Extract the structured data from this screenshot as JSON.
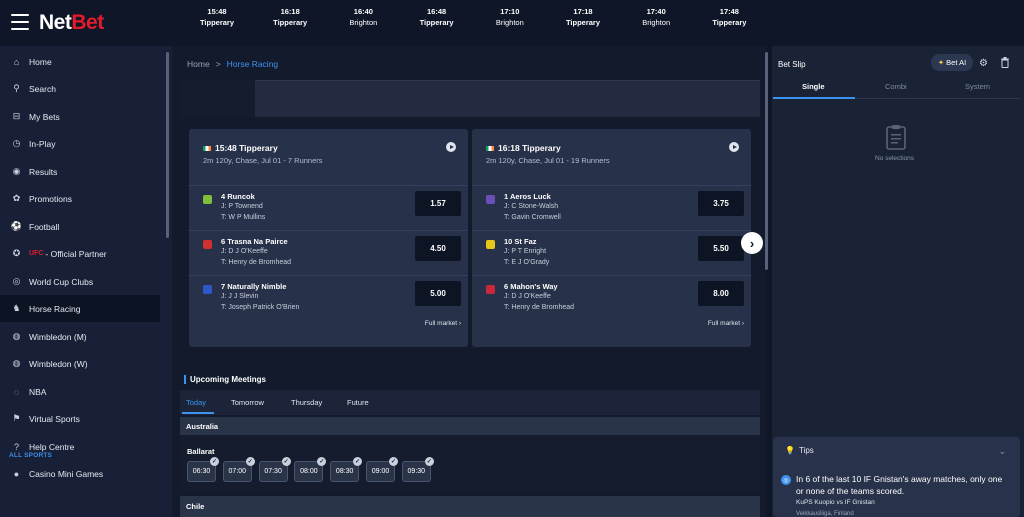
{
  "brand": {
    "logo_part1": "Net",
    "logo_part2": "Bet"
  },
  "sidebar": {
    "items": [
      {
        "label": "Home",
        "icon": "home-icon",
        "glyph": "⌂"
      },
      {
        "label": "Search",
        "icon": "search-icon",
        "glyph": "⚲"
      },
      {
        "label": "My Bets",
        "icon": "receipt-icon",
        "glyph": "⊟"
      },
      {
        "label": "In-Play",
        "icon": "stopwatch-icon",
        "glyph": "◷"
      },
      {
        "label": "Results",
        "icon": "eye-icon",
        "glyph": "◉"
      },
      {
        "label": "Promotions",
        "icon": "gift-icon",
        "glyph": "✿"
      },
      {
        "label": "Football",
        "icon": "football-icon",
        "glyph": "⚽"
      },
      {
        "label": "- Official Partner",
        "prefix": "UFC",
        "icon": "ufc-icon",
        "glyph": "✪"
      },
      {
        "label": "World Cup Clubs",
        "icon": "globe-icon",
        "glyph": "◎"
      },
      {
        "label": "Horse Racing",
        "icon": "horse-icon",
        "glyph": "♞"
      },
      {
        "label": "Wimbledon (M)",
        "icon": "tennis-ball-icon",
        "glyph": "◍"
      },
      {
        "label": "Wimbledon (W)",
        "icon": "tennis-ball-icon",
        "glyph": "◍"
      },
      {
        "label": "NBA",
        "icon": "basketball-icon",
        "glyph": "◌"
      },
      {
        "label": "Virtual Sports",
        "icon": "virtual-icon",
        "glyph": "⚑"
      },
      {
        "label": "Help Centre",
        "icon": "help-icon",
        "glyph": "?"
      },
      {
        "label": "Casino Mini Games",
        "icon": "casino-icon",
        "glyph": "●"
      }
    ],
    "all_sports": "ALL SPORTS"
  },
  "breadcrumb": {
    "home": "Home",
    "sep": ">",
    "current": "Horse Racing"
  },
  "races": [
    {
      "time": "15:48",
      "track": "Tipperary"
    },
    {
      "time": "16:18",
      "track": "Tipperary"
    },
    {
      "time": "16:40",
      "track": "Brighton"
    },
    {
      "time": "16:48",
      "track": "Tipperary"
    },
    {
      "time": "17:10",
      "track": "Brighton"
    },
    {
      "time": "17:18",
      "track": "Tipperary"
    },
    {
      "time": "17:40",
      "track": "Brighton"
    },
    {
      "time": "17:48",
      "track": "Tipperary"
    }
  ],
  "cards": [
    {
      "title": "15:48 Tipperary",
      "subtitle": "2m 120y, Chase, Jul 01 - 7 Runners",
      "full_market": "Full market ›",
      "runners": [
        {
          "name": "4 Runcok",
          "jockey": "J: P Townend",
          "trainer": "T: W P Mullins",
          "odds": "1.57",
          "silk": "#7fbf3a"
        },
        {
          "name": "6 Trasna Na Pairce",
          "jockey": "J: D J O'Keeffe",
          "trainer": "T: Henry de Bromhead",
          "odds": "4.50",
          "silk": "#d2302f"
        },
        {
          "name": "7 Naturally Nimble",
          "jockey": "J: J J Slevin",
          "trainer": "T: Joseph Patrick O'Brien",
          "odds": "5.00",
          "silk": "#2f57c9"
        }
      ]
    },
    {
      "title": "16:18 Tipperary",
      "subtitle": "2m 120y, Chase, Jul 01 - 19 Runners",
      "full_market": "Full market ›",
      "runners": [
        {
          "name": "1 Aeros Luck",
          "jockey": "J: C Stone-Walsh",
          "trainer": "T: Gavin Cromwell",
          "odds": "3.75",
          "silk": "#6a4fb6"
        },
        {
          "name": "10 St Faz",
          "jockey": "J: P T Enright",
          "trainer": "T: E J O'Grady",
          "odds": "5.50",
          "silk": "#e8c51b"
        },
        {
          "name": "6 Mahon's Way",
          "jockey": "J: D J O'Keeffe",
          "trainer": "T: Henry de Bromhead",
          "odds": "8.00",
          "silk": "#c9283b"
        }
      ]
    }
  ],
  "upcoming": {
    "title": "Upcoming Meetings",
    "tabs": [
      "Today",
      "Tomorrow",
      "Thursday",
      "Future"
    ],
    "country1": "Australia",
    "venue": "Ballarat",
    "times": [
      "06:30",
      "07:00",
      "07:30",
      "08:00",
      "08:30",
      "09:00",
      "09:30"
    ],
    "country2": "Chile"
  },
  "betslip": {
    "title": "Bet Slip",
    "bet_ai": "Bet AI",
    "tabs": [
      "Single",
      "Combi",
      "System"
    ],
    "no_selections": "No selections"
  },
  "tips": {
    "title": "Tips",
    "text": "In 6 of the last 10 IF Gnistan's away matches, only one or none of the teams scored.",
    "match": "KuPS Kuopio vs IF Gnistan",
    "location": "Veikkausliiga, Finland"
  },
  "colors": {
    "accent": "#3d93f0",
    "brand_red": "#e21b2c"
  }
}
